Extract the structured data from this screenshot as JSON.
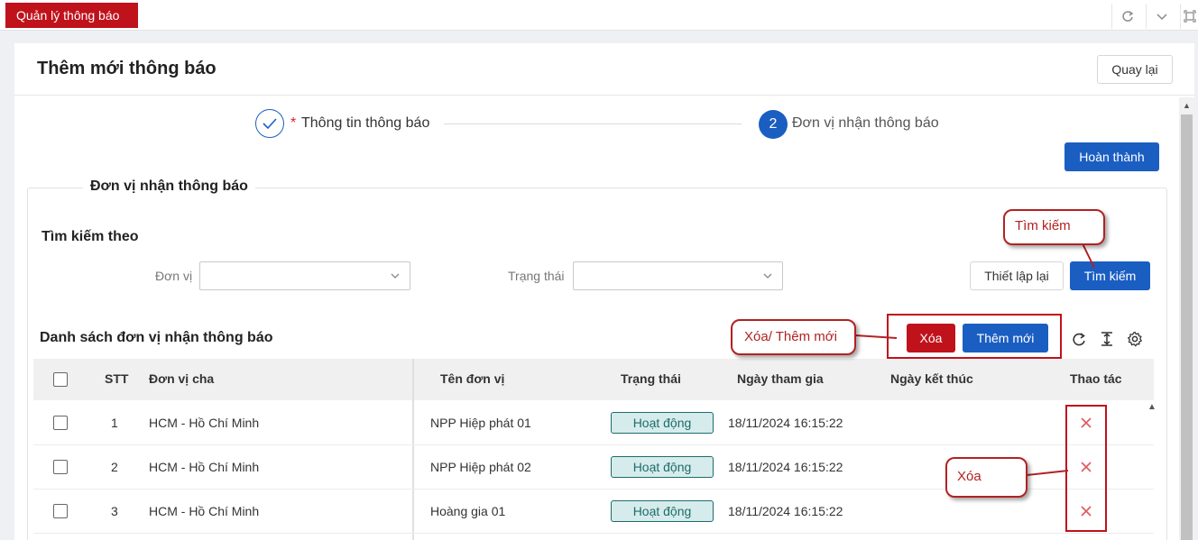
{
  "top_tab": {
    "label": "Quản lý thông báo"
  },
  "page": {
    "title": "Thêm mới thông báo",
    "back_label": "Quay lại"
  },
  "stepper": {
    "step1": {
      "required_mark": "*",
      "label": "Thông tin thông báo"
    },
    "step2": {
      "number": "2",
      "label": "Đơn vị nhận thông báo"
    }
  },
  "finish_label": "Hoàn thành",
  "section": {
    "legend": "Đơn vị nhận thông báo"
  },
  "search": {
    "title": "Tìm kiếm theo",
    "unit_label": "Đơn vị",
    "status_label": "Trạng thái",
    "reset_label": "Thiết lập lại",
    "search_label": "Tìm kiếm"
  },
  "list": {
    "title": "Danh sách đơn vị nhận thông báo",
    "delete_label": "Xóa",
    "add_label": "Thêm mới"
  },
  "table": {
    "headers": {
      "stt": "STT",
      "parent": "Đơn vị cha",
      "name": "Tên đơn vị",
      "status": "Trạng thái",
      "join_date": "Ngày tham gia",
      "end_date": "Ngày kết thúc",
      "actions": "Thao tác"
    },
    "rows": [
      {
        "stt": "1",
        "parent": "HCM - Hồ Chí Minh",
        "name": "NPP Hiệp phát 01",
        "status": "Hoạt động",
        "join_date": "18/11/2024 16:15:22"
      },
      {
        "stt": "2",
        "parent": "HCM - Hồ Chí Minh",
        "name": "NPP Hiệp phát 02",
        "status": "Hoạt động",
        "join_date": "18/11/2024 16:15:22"
      },
      {
        "stt": "3",
        "parent": "HCM - Hồ Chí Minh",
        "name": "Hoàng gia 01",
        "status": "Hoạt động",
        "join_date": "18/11/2024 16:15:22"
      }
    ]
  },
  "callouts": {
    "search": "Tìm kiếm",
    "delete_add": "Xóa/ Thêm mới",
    "delete": "Xóa"
  },
  "colors": {
    "brand_red": "#c0121b",
    "primary_blue": "#1b5ec2",
    "status_teal": "#1f6b6b"
  }
}
